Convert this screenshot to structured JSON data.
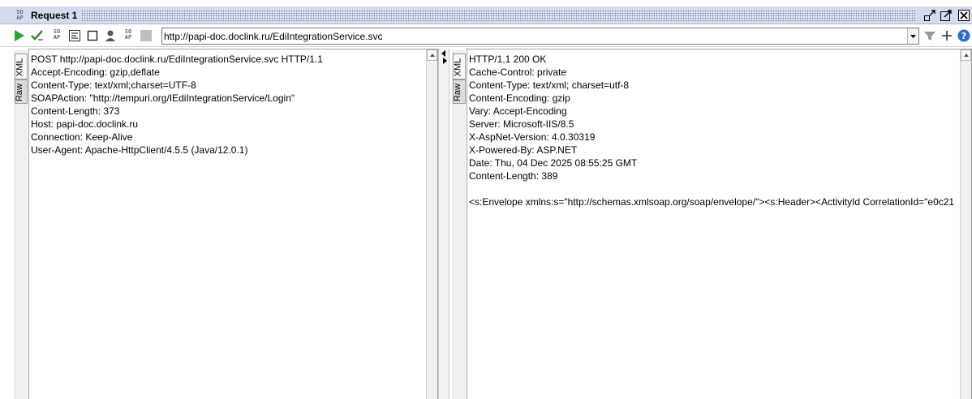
{
  "window": {
    "title": "Request 1",
    "soap_badge": "SO AP"
  },
  "toolbar": {
    "url": "http://papi-doc.doclink.ru/EdiIntegrationService.svc",
    "icons": [
      "run-icon",
      "validate-icon",
      "soap-icon",
      "format-icon",
      "stop-icon",
      "user-icon",
      "soap-settings-icon",
      "square-icon"
    ],
    "right_icons": [
      "filter-icon",
      "add-icon",
      "help-icon"
    ]
  },
  "request": {
    "tabs": [
      "XML",
      "Raw"
    ],
    "active_tab": "Raw",
    "lines": [
      "POST http://papi-doc.doclink.ru/EdiIntegrationService.svc HTTP/1.1",
      "Accept-Encoding: gzip,deflate",
      "Content-Type: text/xml;charset=UTF-8",
      "SOAPAction: \"http://tempuri.org/IEdiIntegrationService/Login\"",
      "Content-Length: 373",
      "Host: papi-doc.doclink.ru",
      "Connection: Keep-Alive",
      "User-Agent: Apache-HttpClient/4.5.5 (Java/12.0.1)"
    ]
  },
  "response": {
    "tabs": [
      "XML",
      "Raw"
    ],
    "active_tab": "Raw",
    "lines": [
      "HTTP/1.1 200 OK",
      "Cache-Control: private",
      "Content-Type: text/xml; charset=utf-8",
      "Content-Encoding: gzip",
      "Vary: Accept-Encoding",
      "Server: Microsoft-IIS/8.5",
      "X-AspNet-Version: 4.0.30319",
      "X-Powered-By: ASP.NET",
      "Date: Thu, 04 Dec 2025 08:55:25 GMT",
      "Content-Length: 389",
      "",
      "<s:Envelope xmlns:s=\"http://schemas.xmlsoap.org/soap/envelope/\"><s:Header><ActivityId CorrelationId=\"e0c21"
    ]
  },
  "colors": {
    "run_green": "#2fa02f",
    "help_blue": "#2d6fc7",
    "title_bg": "#d4dbee"
  }
}
